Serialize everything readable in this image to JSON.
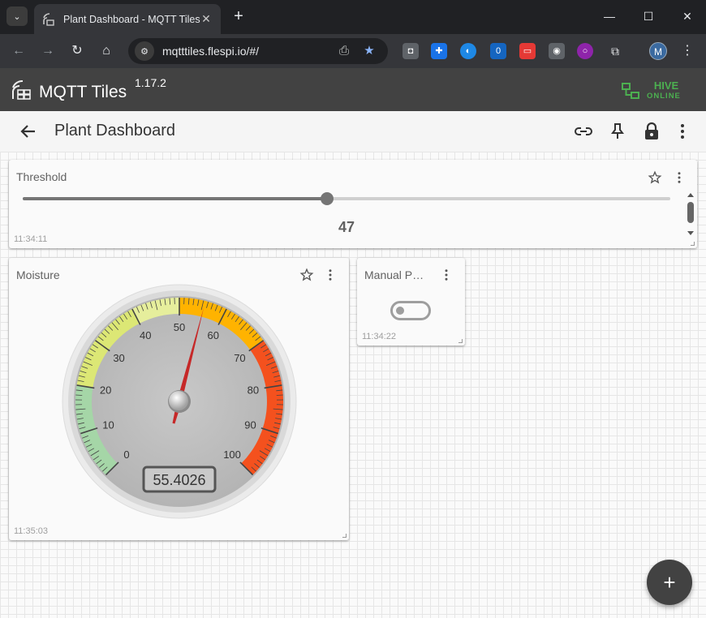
{
  "browser": {
    "tab_title": "Plant Dashboard - MQTT Tiles",
    "url": "mqtttiles.flespi.io/#/",
    "profile_initial": "M",
    "extension_badge": "0"
  },
  "app": {
    "title": "MQTT Tiles",
    "version": "1.17.2",
    "broker_name": "HIVE",
    "broker_status": "ONLINE",
    "accent_color": "#4caf50"
  },
  "page": {
    "title": "Plant Dashboard"
  },
  "tiles": {
    "threshold": {
      "title": "Threshold",
      "value": "47",
      "slider_fraction": 0.47,
      "timestamp": "11:34:11"
    },
    "moisture": {
      "title": "Moisture",
      "value": 55.4026,
      "value_text": "55.4026",
      "min": 0,
      "max": 100,
      "tick_labels": [
        "0",
        "10",
        "20",
        "30",
        "40",
        "50",
        "60",
        "70",
        "80",
        "90",
        "100"
      ],
      "zones": [
        {
          "from": 0,
          "to": 20,
          "color": "#a5d6a7"
        },
        {
          "from": 20,
          "to": 40,
          "color": "#dce775"
        },
        {
          "from": 40,
          "to": 50,
          "color": "#e6ee9c"
        },
        {
          "from": 50,
          "to": 70,
          "color": "#ffb300"
        },
        {
          "from": 70,
          "to": 100,
          "color": "#f4511e"
        }
      ],
      "timestamp": "11:35:03"
    },
    "manual": {
      "title": "Manual P…",
      "state": "off",
      "timestamp": "11:34:22"
    }
  },
  "fab": {
    "label": "+"
  }
}
